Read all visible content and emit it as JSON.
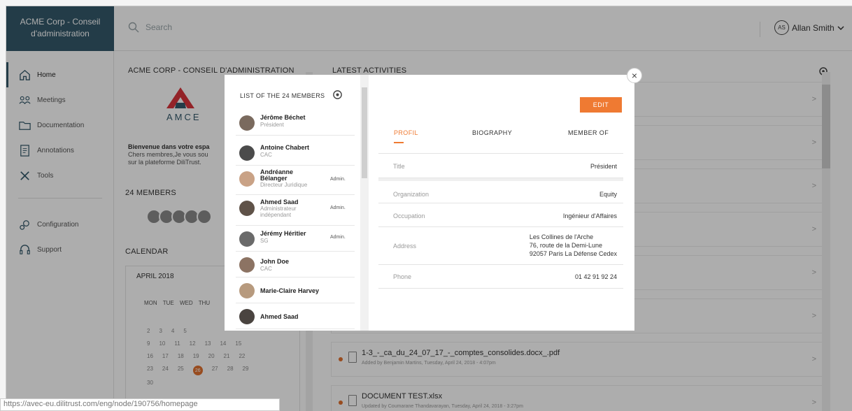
{
  "topbar": {
    "brand_line1": "ACME Corp - Conseil",
    "brand_line2": "d'administration",
    "search_placeholder": "Search",
    "user_initials": "AS",
    "user_name": "Allan Smith"
  },
  "sidebar": {
    "items": [
      {
        "label": "Home",
        "icon": "home-icon"
      },
      {
        "label": "Meetings",
        "icon": "meetings-icon"
      },
      {
        "label": "Documentation",
        "icon": "folder-icon"
      },
      {
        "label": "Annotations",
        "icon": "annotations-icon"
      },
      {
        "label": "Tools",
        "icon": "tools-icon"
      },
      {
        "label": "Configuration",
        "icon": "configuration-icon"
      },
      {
        "label": "Support",
        "icon": "support-icon"
      }
    ]
  },
  "main": {
    "board_title": "ACME CORP - CONSEIL D'ADMINISTRATION",
    "logo_text": "AMCE",
    "welcome_title": "Bienvenue dans votre espa",
    "welcome_line1": "Chers membres,Je vous sou",
    "welcome_line2": "sur la plateforme DiliTrust.",
    "members_title": "24 MEMBERS",
    "calendar_title": "CALENDAR",
    "calendar_month": "APRIL 2018",
    "calendar_days": "MON TUE WED THU",
    "calendar_rows": [
      [
        "2",
        "3",
        "4",
        "5"
      ],
      [
        "9",
        "10",
        "11",
        "12",
        "13",
        "14",
        "15"
      ],
      [
        "16",
        "17",
        "18",
        "19",
        "20",
        "21",
        "22"
      ],
      [
        "23",
        "24",
        "25",
        "26",
        "27",
        "28",
        "29"
      ],
      [
        "30"
      ]
    ],
    "activities_title": "LATEST ACTIVITIES",
    "activities": [
      {
        "title": "1-3_-_ca_du_24_07_17_-_comptes_consolides.docx_.pdf",
        "sub_prefix": "Added by ",
        "sub_author": "Benjamin Martins",
        "sub_suffix": ", Tuesday, April 24, 2018 - 4:07pm"
      },
      {
        "title": "DOCUMENT TEST.xlsx",
        "sub_prefix": "Updated by ",
        "sub_author": "Coumarane Thandavarayan",
        "sub_suffix": ", Tuesday, April 24, 2018 - 3:27pm"
      }
    ]
  },
  "modal": {
    "list_title": "LIST OF THE 24 MEMBERS",
    "members": [
      {
        "name": "Jérôme Béchet",
        "role": "Président",
        "admin": ""
      },
      {
        "name": "Antoine Chabert",
        "role": "CAC",
        "admin": ""
      },
      {
        "name": "Andréanne Bélanger",
        "name_line1": "Andréanne",
        "name_line2": "Bélanger",
        "role": "Directeur Juridique",
        "admin": "Admin."
      },
      {
        "name": "Ahmed Saad",
        "role_line1": "Administrateur",
        "role_line2": "indépendant",
        "admin": "Admin."
      },
      {
        "name": "Jérémy Héritier",
        "role": "SG",
        "admin": "Admin."
      },
      {
        "name": "John Doe",
        "role": "CAC",
        "admin": ""
      },
      {
        "name": "Marie-Claire Harvey",
        "role": "",
        "admin": ""
      },
      {
        "name": "Ahmed Saad",
        "role": "",
        "admin": ""
      }
    ],
    "edit_label": "EDIT",
    "tabs": [
      "PROFIL",
      "BIOGRAPHY",
      "MEMBER OF"
    ],
    "profile": {
      "title_label": "Title",
      "title_value": "Président",
      "org_label": "Organization",
      "org_value": "Equity",
      "occupation_label": "Occupation",
      "occupation_value": "Ingénieur d'Affaires",
      "address_label": "Address",
      "address_line1": "Les Collines de l'Arche",
      "address_line2": "76, route de la Demi-Lune",
      "address_line3": "92057 Paris La Défense Cedex",
      "phone_label": "Phone",
      "phone_value": "01 42 91 92 24"
    },
    "close_symbol": "×"
  },
  "status_url": "https://avec-eu.dilitrust.com/eng/node/190756/homepage",
  "colors": {
    "brand": "#34596b",
    "accent": "#ef7a32"
  }
}
